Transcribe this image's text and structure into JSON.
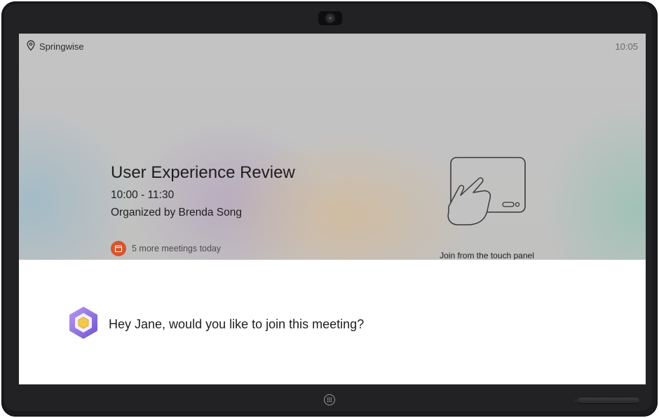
{
  "header": {
    "location": "Springwise",
    "time": "10:05"
  },
  "meeting": {
    "title": "User Experience Review",
    "time_range": "10:00 - 11:30",
    "organizer": "Organized by Brenda Song",
    "more_meetings": "5 more meetings today"
  },
  "join_hint": {
    "label": "Join from the touch panel"
  },
  "assistant": {
    "message": "Hey Jane, would you like to join this meeting?"
  },
  "colors": {
    "badge": "#d9532c",
    "assistant_outer": "#8e6fe0",
    "assistant_inner": "#f2c94c",
    "bezel": "#1b1b1d"
  },
  "icons": {
    "location": "location-pin-icon",
    "calendar": "calendar-icon",
    "touch_panel": "touch-panel-icon",
    "assistant": "assistant-logo-icon",
    "home": "home-button-icon"
  }
}
